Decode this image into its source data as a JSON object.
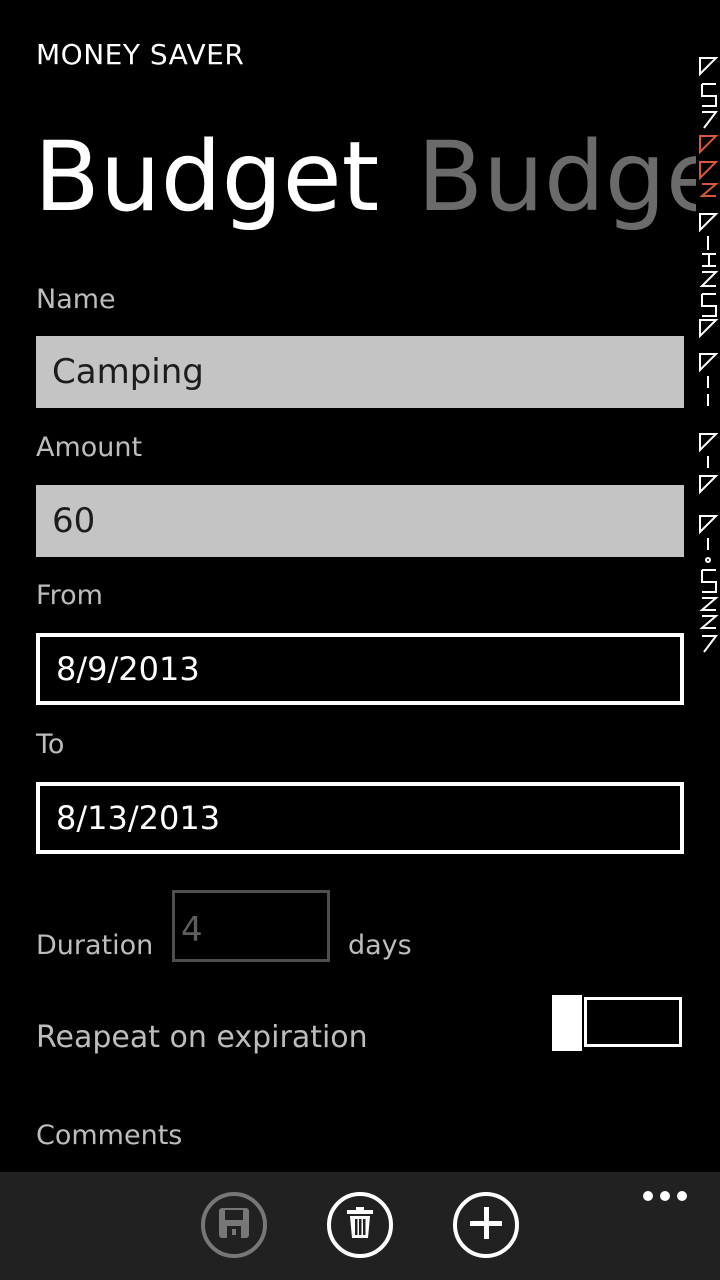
{
  "app": {
    "title": "MONEY SAVER"
  },
  "pivot": {
    "active": "Budget",
    "next": "Budget"
  },
  "form": {
    "name_label": "Name",
    "name_value": "Camping",
    "amount_label": "Amount",
    "amount_value": "60",
    "from_label": "From",
    "from_value": "8/9/2013",
    "to_label": "To",
    "to_value": "8/13/2013",
    "duration_label": "Duration",
    "duration_value": "4",
    "duration_unit": "days",
    "repeat_label": "Reapeat on expiration",
    "repeat_on": false,
    "comments_label": "Comments"
  },
  "appbar": {
    "buttons": [
      {
        "icon": "save-icon",
        "enabled": false
      },
      {
        "icon": "delete-icon",
        "enabled": true
      },
      {
        "icon": "add-icon",
        "enabled": true
      }
    ],
    "more_icon": "ellipsis-icon"
  },
  "colors": {
    "background": "#000000",
    "field_fill": "#c4c4c4",
    "label": "#bdbdbd",
    "inactive_pivot": "#6b6b6b",
    "appbar": "#212121"
  }
}
